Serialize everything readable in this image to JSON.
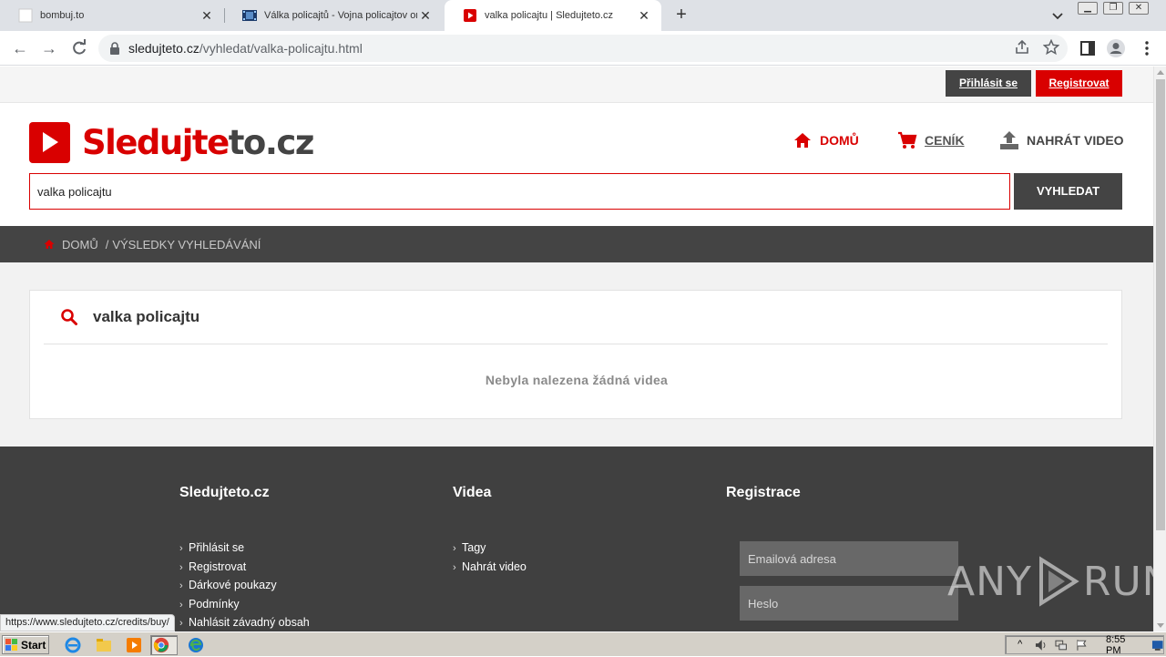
{
  "browser": {
    "tabs": [
      {
        "title": "bombuj.to",
        "active": false
      },
      {
        "title": "Válka policajtů - Vojna policajtov online",
        "active": false
      },
      {
        "title": "valka policajtu | Sledujteto.cz",
        "active": true
      }
    ],
    "url_host": "sledujteto.cz",
    "url_path": "/vyhledat/valka-policajtu.html",
    "status_url": "https://www.sledujteto.cz/credits/buy/"
  },
  "site": {
    "accent_color": "#d90000",
    "topbar": {
      "login_label": "Přihlásit se",
      "register_label": "Registrovat"
    },
    "logo": {
      "part1": "Sledujte",
      "part2": "to.cz"
    },
    "nav": {
      "home": "DOMŮ",
      "pricing": "CENÍK",
      "upload": "NAHRÁT VIDEO"
    },
    "search": {
      "value": "valka policajtu",
      "button": "VYHLEDAT"
    },
    "breadcrumb": {
      "home": "DOMŮ",
      "separator": "/",
      "current": "VÝSLEDKY VYHLEDÁVÁNÍ"
    },
    "results": {
      "query": "valka policajtu",
      "empty_message": "Nebyla nalezena žádná videa"
    },
    "footer": {
      "col1": {
        "title": "Sledujteto.cz",
        "links": [
          "Přihlásit se",
          "Registrovat",
          "Dárkové poukazy",
          "Podmínky",
          "Nahlásit závadný obsah"
        ]
      },
      "col2": {
        "title": "Videa",
        "links": [
          "Tagy",
          "Nahrát video"
        ]
      },
      "col3": {
        "title": "Registrace",
        "email_placeholder": "Emailová adresa",
        "password_placeholder": "Heslo"
      }
    },
    "watermark": {
      "left": "ANY",
      "right": "RUN"
    }
  },
  "taskbar": {
    "start_label": "Start",
    "clock": "8:55 PM"
  }
}
